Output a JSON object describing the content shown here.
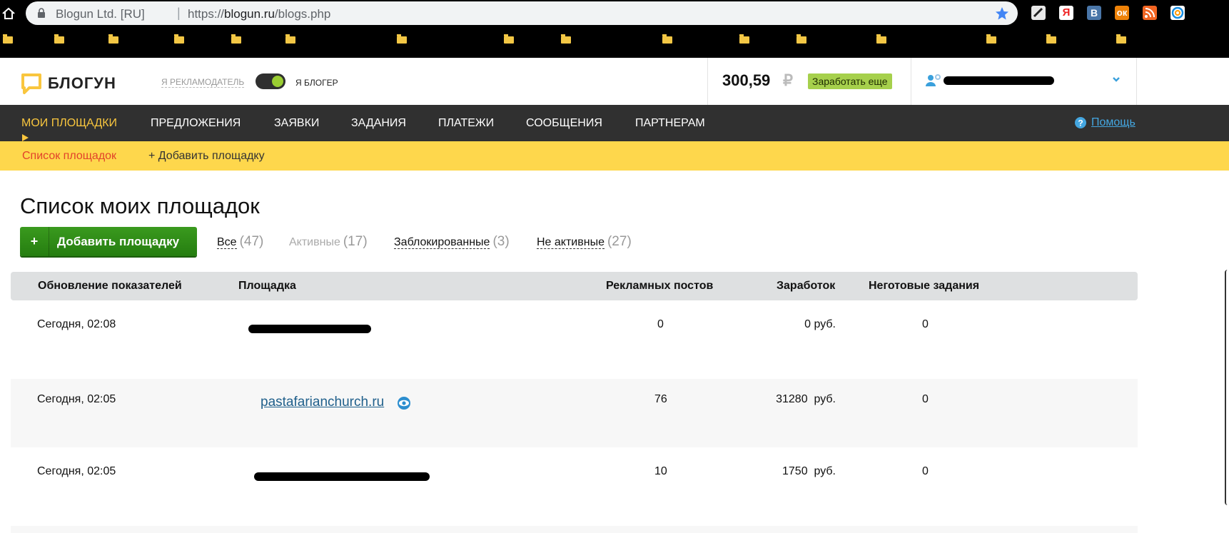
{
  "browser": {
    "site_name": "Blogun Ltd. [RU]",
    "url_prefix": "https://",
    "url_host": "blogun.ru",
    "url_path": "/blogs.php",
    "extensions": [
      "extension-icon",
      "yandex-icon",
      "vk-icon",
      "odnoklassniki-icon",
      "rss-icon",
      "mail-icon"
    ]
  },
  "header": {
    "logo": "БЛОГУН",
    "role_advertiser": "Я РЕКЛАМОДАТЕЛЬ",
    "role_blogger": "Я БЛОГЕР",
    "balance": "300,59",
    "currency": "₽",
    "earn_more": "Заработать еще"
  },
  "nav": {
    "items": [
      "МОИ ПЛОЩАДКИ",
      "ПРЕДЛОЖЕНИЯ",
      "ЗАЯВКИ",
      "ЗАДАНИЯ",
      "ПЛАТЕЖИ",
      "СООБЩЕНИЯ",
      "ПАРТНЕРАМ"
    ],
    "help": "Помощь"
  },
  "subnav": {
    "list": "Список площадок",
    "add": "+ Добавить площадку"
  },
  "page": {
    "title": "Список моих площадок",
    "add_button_plus": "+",
    "add_button_label": "Добавить площадку"
  },
  "filters": [
    {
      "label": "Все",
      "count": "(47)"
    },
    {
      "label": "Активные",
      "count": "(17)"
    },
    {
      "label": "Заблокированные",
      "count": "(3)"
    },
    {
      "label": "Не активные",
      "count": "(27)"
    }
  ],
  "table": {
    "headers": [
      "Обновление показателей",
      "Площадка",
      "Рекламных постов",
      "Заработок",
      "Неготовые задания"
    ],
    "rows": [
      {
        "updated": "Сегодня, 02:08",
        "site": "",
        "posts": "0",
        "earnings": "0 руб.",
        "pending": "0"
      },
      {
        "updated": "Сегодня, 02:05",
        "site": "pastafarianchurch.ru",
        "posts": "76",
        "earnings": "31280  руб.",
        "pending": "0"
      },
      {
        "updated": "Сегодня, 02:05",
        "site": "",
        "posts": "10",
        "earnings": "1750  руб.",
        "pending": "0"
      }
    ]
  },
  "colors": {
    "nav_bg": "#303030",
    "nav_active": "#f9c63e",
    "subnav_bg": "#fed74c",
    "button_green": "#257d10",
    "link_blue": "#1f5f8b"
  }
}
